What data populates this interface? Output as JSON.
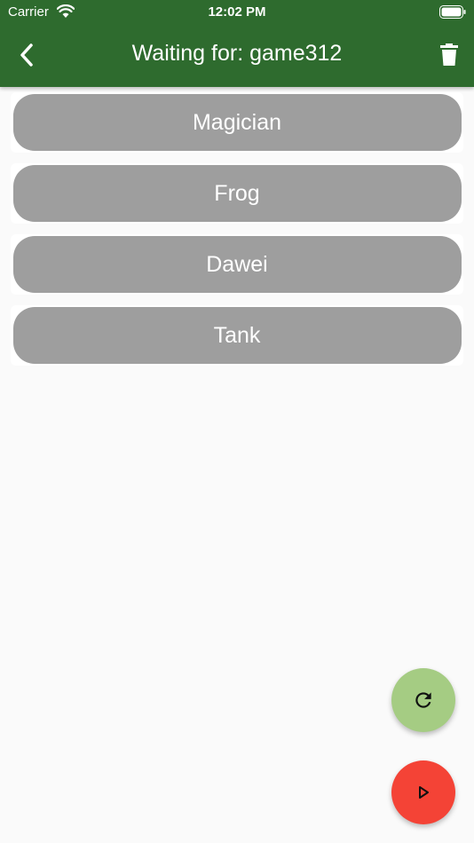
{
  "status_bar": {
    "carrier": "Carrier",
    "time": "12:02 PM"
  },
  "app_bar": {
    "title": "Waiting for: game312",
    "back_icon": "chevron-left-icon",
    "delete_icon": "trash-icon",
    "color": "#2e6b2e"
  },
  "players": [
    {
      "name": "Magician"
    },
    {
      "name": "Frog"
    },
    {
      "name": "Dawei"
    },
    {
      "name": "Tank"
    }
  ],
  "fabs": {
    "refresh": {
      "icon": "refresh-icon",
      "color": "#a5cc83"
    },
    "start": {
      "icon": "play-icon",
      "color": "#f44336"
    }
  }
}
